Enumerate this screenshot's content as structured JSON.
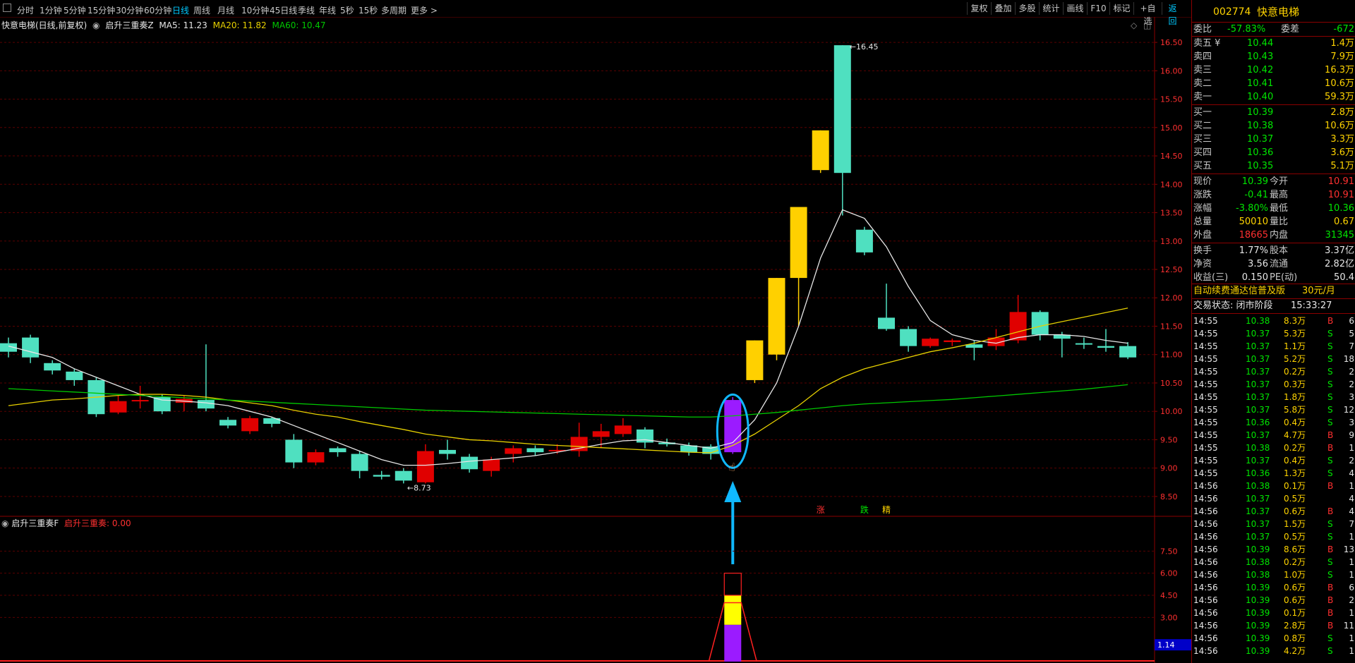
{
  "toolbar": {
    "periods": [
      "分时",
      "1分钟",
      "5分钟",
      "15分钟",
      "30分钟",
      "60分钟",
      "日线",
      "周线",
      "月线",
      "10分钟",
      "45日线",
      "季线",
      "年线",
      "5秒",
      "15秒",
      "多周期",
      "更多 >"
    ],
    "active_period": "日线",
    "right_buttons": [
      "复权",
      "叠加",
      "多股",
      "统计",
      "画线",
      "F10",
      "标记",
      "+自选",
      "返回"
    ]
  },
  "chart_header": {
    "stock_title": "快意电梯(日线,前复权)",
    "indicator_name": "启升三重奏Z",
    "ma5": "MA5: 11.23",
    "ma20": "MA20: 11.82",
    "ma60": "MA60: 10.47"
  },
  "indicator_header": {
    "name": "启升三重奏F",
    "value_label": "启升三重奏: 0.00"
  },
  "chart_data": [
    {
      "type": "candlestick",
      "title": "快意电梯(日线,前复权)",
      "y_ticks": [
        "16.50",
        "16.00",
        "15.50",
        "15.00",
        "14.50",
        "14.00",
        "13.50",
        "13.00",
        "12.50",
        "12.00",
        "11.50",
        "11.00",
        "10.50",
        "10.00",
        "9.50",
        "9.00",
        "8.50"
      ],
      "ylim": [
        8.3,
        16.7
      ],
      "high_label": "16.45",
      "low_label": "8.73",
      "candles": [
        {
          "o": 11.2,
          "c": 11.05,
          "h": 11.3,
          "l": 10.95
        },
        {
          "o": 11.3,
          "c": 10.95,
          "h": 11.35,
          "l": 10.85
        },
        {
          "o": 10.85,
          "c": 10.72,
          "h": 10.9,
          "l": 10.65
        },
        {
          "o": 10.7,
          "c": 10.55,
          "h": 10.75,
          "l": 10.45
        },
        {
          "o": 10.55,
          "c": 9.95,
          "h": 10.6,
          "l": 9.9
        },
        {
          "o": 9.98,
          "c": 10.18,
          "h": 10.28,
          "l": 9.95
        },
        {
          "o": 10.18,
          "c": 10.2,
          "h": 10.45,
          "l": 10.05
        },
        {
          "o": 10.25,
          "c": 10.0,
          "h": 10.3,
          "l": 9.95
        },
        {
          "o": 10.15,
          "c": 10.22,
          "h": 10.28,
          "l": 10.0
        },
        {
          "o": 10.2,
          "c": 10.05,
          "h": 11.18,
          "l": 10.0
        },
        {
          "o": 9.85,
          "c": 9.75,
          "h": 9.9,
          "l": 9.7
        },
        {
          "o": 9.65,
          "c": 9.88,
          "h": 9.92,
          "l": 9.6
        },
        {
          "o": 9.88,
          "c": 9.78,
          "h": 9.9,
          "l": 9.72
        },
        {
          "o": 9.5,
          "c": 9.1,
          "h": 9.6,
          "l": 9.0
        },
        {
          "o": 9.1,
          "c": 9.28,
          "h": 9.33,
          "l": 9.05
        },
        {
          "o": 9.35,
          "c": 9.28,
          "h": 9.38,
          "l": 9.2
        },
        {
          "o": 9.25,
          "c": 8.95,
          "h": 9.3,
          "l": 8.82
        },
        {
          "o": 8.88,
          "c": 8.85,
          "h": 8.95,
          "l": 8.8
        },
        {
          "o": 8.95,
          "c": 8.78,
          "h": 9.0,
          "l": 8.73
        },
        {
          "o": 8.75,
          "c": 9.3,
          "h": 9.42,
          "l": 8.73
        },
        {
          "o": 9.32,
          "c": 9.25,
          "h": 9.5,
          "l": 9.15
        },
        {
          "o": 9.2,
          "c": 8.98,
          "h": 9.25,
          "l": 8.92
        },
        {
          "o": 8.95,
          "c": 9.15,
          "h": 9.2,
          "l": 8.85
        },
        {
          "o": 9.25,
          "c": 9.35,
          "h": 9.4,
          "l": 9.1
        },
        {
          "o": 9.35,
          "c": 9.28,
          "h": 9.4,
          "l": 9.22
        },
        {
          "o": 9.3,
          "c": 9.32,
          "h": 9.42,
          "l": 9.25
        },
        {
          "o": 9.3,
          "c": 9.55,
          "h": 9.8,
          "l": 9.2
        },
        {
          "o": 9.55,
          "c": 9.65,
          "h": 9.78,
          "l": 9.35
        },
        {
          "o": 9.6,
          "c": 9.75,
          "h": 9.88,
          "l": 9.55
        },
        {
          "o": 9.68,
          "c": 9.45,
          "h": 9.72,
          "l": 9.35
        },
        {
          "o": 9.45,
          "c": 9.42,
          "h": 9.52,
          "l": 9.38
        },
        {
          "o": 9.4,
          "c": 9.28,
          "h": 9.45,
          "l": 9.22
        },
        {
          "o": 9.38,
          "c": 9.25,
          "h": 9.42,
          "l": 9.15
        },
        {
          "o": 9.28,
          "c": 10.2,
          "h": 10.25,
          "l": 9.25
        },
        {
          "o": 10.55,
          "c": 11.25,
          "h": 11.25,
          "l": 10.5
        },
        {
          "o": 11.0,
          "c": 12.35,
          "h": 12.35,
          "l": 10.9
        },
        {
          "o": 12.35,
          "c": 13.6,
          "h": 13.6,
          "l": 11.5
        },
        {
          "o": 14.25,
          "c": 14.95,
          "h": 14.95,
          "l": 14.2
        },
        {
          "o": 16.45,
          "c": 14.2,
          "h": 16.45,
          "l": 13.45
        },
        {
          "o": 13.2,
          "c": 12.8,
          "h": 13.25,
          "l": 12.75
        },
        {
          "o": 11.65,
          "c": 11.45,
          "h": 12.25,
          "l": 11.42
        },
        {
          "o": 11.45,
          "c": 11.15,
          "h": 11.5,
          "l": 11.05
        },
        {
          "o": 11.15,
          "c": 11.28,
          "h": 11.3,
          "l": 11.12
        },
        {
          "o": 11.22,
          "c": 11.25,
          "h": 11.28,
          "l": 11.15
        },
        {
          "o": 11.18,
          "c": 11.12,
          "h": 11.25,
          "l": 10.9
        },
        {
          "o": 11.15,
          "c": 11.3,
          "h": 11.45,
          "l": 11.08
        },
        {
          "o": 11.25,
          "c": 11.75,
          "h": 12.05,
          "l": 11.2
        },
        {
          "o": 11.75,
          "c": 11.35,
          "h": 11.78,
          "l": 11.25
        },
        {
          "o": 11.35,
          "c": 11.28,
          "h": 11.4,
          "l": 10.95
        },
        {
          "o": 11.2,
          "c": 11.18,
          "h": 11.3,
          "l": 11.1
        },
        {
          "o": 11.15,
          "c": 11.12,
          "h": 11.45,
          "l": 11.05
        },
        {
          "o": 11.15,
          "c": 10.95,
          "h": 11.22,
          "l": 10.92
        }
      ],
      "candle_styles": {
        "down": "#4fe0c0",
        "up": "#e00000",
        "gold": "#ffd000",
        "signal": "#9b1bff"
      },
      "gold_candles": [
        34,
        35,
        36,
        37
      ],
      "signal_candle": 33,
      "series": [
        {
          "name": "MA5",
          "color": "#e6e6e6",
          "values": [
            11.15,
            11.05,
            10.95,
            10.75,
            10.6,
            10.45,
            10.3,
            10.2,
            10.18,
            10.15,
            10.1,
            10.0,
            9.9,
            9.75,
            9.6,
            9.45,
            9.3,
            9.15,
            9.05,
            9.05,
            9.08,
            9.12,
            9.15,
            9.18,
            9.22,
            9.28,
            9.35,
            9.42,
            9.48,
            9.5,
            9.45,
            9.4,
            9.35,
            9.45,
            9.85,
            10.5,
            11.5,
            12.7,
            13.55,
            13.4,
            12.9,
            12.2,
            11.6,
            11.35,
            11.25,
            11.2,
            11.3,
            11.35,
            11.35,
            11.32,
            11.25,
            11.2
          ]
        },
        {
          "name": "MA20",
          "color": "#e6d000",
          "values": [
            10.1,
            10.15,
            10.2,
            10.22,
            10.25,
            10.28,
            10.3,
            10.3,
            10.28,
            10.25,
            10.2,
            10.15,
            10.1,
            10.02,
            9.95,
            9.9,
            9.82,
            9.75,
            9.68,
            9.6,
            9.55,
            9.5,
            9.48,
            9.45,
            9.42,
            9.4,
            9.38,
            9.36,
            9.34,
            9.32,
            9.3,
            9.28,
            9.27,
            9.4,
            9.6,
            9.85,
            10.1,
            10.4,
            10.6,
            10.75,
            10.85,
            10.95,
            11.05,
            11.12,
            11.2,
            11.3,
            11.4,
            11.5,
            11.58,
            11.66,
            11.74,
            11.82
          ]
        },
        {
          "name": "MA60",
          "color": "#00c800",
          "values": [
            10.4,
            10.38,
            10.36,
            10.34,
            10.32,
            10.3,
            10.28,
            10.26,
            10.24,
            10.22,
            10.2,
            10.18,
            10.16,
            10.14,
            10.12,
            10.1,
            10.08,
            10.06,
            10.04,
            10.02,
            10.01,
            10.0,
            9.99,
            9.98,
            9.97,
            9.96,
            9.95,
            9.94,
            9.93,
            9.92,
            9.91,
            9.9,
            9.9,
            9.92,
            9.95,
            9.98,
            10.02,
            10.06,
            10.1,
            10.13,
            10.15,
            10.17,
            10.19,
            10.21,
            10.24,
            10.27,
            10.3,
            10.33,
            10.36,
            10.39,
            10.43,
            10.47
          ]
        }
      ],
      "markers": [
        {
          "index": 37,
          "text": "涨",
          "color": "#ff3030"
        },
        {
          "index": 39,
          "text": "跌",
          "color": "#00e600"
        },
        {
          "index": 40,
          "text": "精",
          "color": "#ffd400"
        }
      ]
    },
    {
      "type": "bar",
      "title": "启升三重奏F",
      "y_ticks": [
        "7.50",
        "6.00",
        "4.50",
        "3.00"
      ],
      "ylim": [
        0,
        9.0
      ],
      "current_value_label": "1.14",
      "signal_index": 33,
      "stack": [
        {
          "from": 0,
          "to": 2.5,
          "color": "#9b1bff"
        },
        {
          "from": 2.5,
          "to": 4.5,
          "color": "#ffff00"
        },
        {
          "from": 4.5,
          "to": 6.0,
          "color": "#000000",
          "outline": "#ff2020"
        }
      ]
    }
  ],
  "quote_panel": {
    "code": "002774",
    "name": "快意电梯",
    "weibi_label": "委比",
    "weibi_value": "-57.83%",
    "weicha_label": "委差",
    "weicha_value": "-672",
    "sells": [
      {
        "label": "卖五 ¥",
        "price": "10.44",
        "vol": "1.4万"
      },
      {
        "label": "卖四",
        "price": "10.43",
        "vol": "7.9万"
      },
      {
        "label": "卖三",
        "price": "10.42",
        "vol": "16.3万"
      },
      {
        "label": "卖二",
        "price": "10.41",
        "vol": "10.6万"
      },
      {
        "label": "卖一",
        "price": "10.40",
        "vol": "59.3万"
      }
    ],
    "buys": [
      {
        "label": "买一",
        "price": "10.39",
        "vol": "2.8万"
      },
      {
        "label": "买二",
        "price": "10.38",
        "vol": "10.6万"
      },
      {
        "label": "买三",
        "price": "10.37",
        "vol": "3.3万"
      },
      {
        "label": "买四",
        "price": "10.36",
        "vol": "3.6万"
      },
      {
        "label": "买五",
        "price": "10.35",
        "vol": "5.1万"
      }
    ],
    "stats": [
      {
        "l1": "现价",
        "v1": "10.39",
        "c1": "green",
        "l2": "今开",
        "v2": "10.91",
        "c2": "red"
      },
      {
        "l1": "涨跌",
        "v1": "-0.41",
        "c1": "green",
        "l2": "最高",
        "v2": "10.91",
        "c2": "red"
      },
      {
        "l1": "涨幅",
        "v1": "-3.80%",
        "c1": "green",
        "l2": "最低",
        "v2": "10.36",
        "c2": "green"
      },
      {
        "l1": "总量",
        "v1": "50010",
        "c1": "yellow",
        "l2": "量比",
        "v2": "0.67",
        "c2": "yellow"
      },
      {
        "l1": "外盘",
        "v1": "18665",
        "c1": "red",
        "l2": "内盘",
        "v2": "31345",
        "c2": "green"
      }
    ],
    "stats2": [
      {
        "l1": "换手",
        "v1": "1.77%",
        "l2": "股本",
        "v2": "3.37亿"
      },
      {
        "l1": "净资",
        "v1": "3.56",
        "l2": "流通",
        "v2": "2.82亿"
      },
      {
        "l1": "收益(三)",
        "v1": "0.150",
        "l2": "PE(动)",
        "v2": "50.4"
      }
    ],
    "ad_text": "自动续费通达信普及版",
    "ad_price": "30元/月",
    "trade_status_label": "交易状态: 闭市阶段",
    "trade_time": "15:33:27"
  },
  "ticks": [
    {
      "t": "14:55",
      "p": "10.38",
      "v": "8.3万",
      "s": "B",
      "n": "6"
    },
    {
      "t": "14:55",
      "p": "10.37",
      "v": "5.3万",
      "s": "S",
      "n": "5"
    },
    {
      "t": "14:55",
      "p": "10.37",
      "v": "1.1万",
      "s": "S",
      "n": "7"
    },
    {
      "t": "14:55",
      "p": "10.37",
      "v": "5.2万",
      "s": "S",
      "n": "18"
    },
    {
      "t": "14:55",
      "p": "10.37",
      "v": "0.2万",
      "s": "S",
      "n": "2"
    },
    {
      "t": "14:55",
      "p": "10.37",
      "v": "0.3万",
      "s": "S",
      "n": "2"
    },
    {
      "t": "14:55",
      "p": "10.37",
      "v": "1.8万",
      "s": "S",
      "n": "3"
    },
    {
      "t": "14:55",
      "p": "10.37",
      "v": "5.8万",
      "s": "S",
      "n": "12"
    },
    {
      "t": "14:55",
      "p": "10.36",
      "v": "0.4万",
      "s": "S",
      "n": "3"
    },
    {
      "t": "14:55",
      "p": "10.37",
      "v": "4.7万",
      "s": "B",
      "n": "9"
    },
    {
      "t": "14:55",
      "p": "10.38",
      "v": "0.2万",
      "s": "B",
      "n": "1"
    },
    {
      "t": "14:55",
      "p": "10.37",
      "v": "0.4万",
      "s": "S",
      "n": "2"
    },
    {
      "t": "14:55",
      "p": "10.36",
      "v": "1.3万",
      "s": "S",
      "n": "4"
    },
    {
      "t": "14:56",
      "p": "10.38",
      "v": "0.1万",
      "s": "B",
      "n": "1"
    },
    {
      "t": "14:56",
      "p": "10.37",
      "v": "0.5万",
      "s": "",
      "n": "4"
    },
    {
      "t": "14:56",
      "p": "10.37",
      "v": "0.6万",
      "s": "B",
      "n": "4"
    },
    {
      "t": "14:56",
      "p": "10.37",
      "v": "1.5万",
      "s": "S",
      "n": "7"
    },
    {
      "t": "14:56",
      "p": "10.37",
      "v": "0.5万",
      "s": "S",
      "n": "1"
    },
    {
      "t": "14:56",
      "p": "10.39",
      "v": "8.6万",
      "s": "B",
      "n": "13"
    },
    {
      "t": "14:56",
      "p": "10.38",
      "v": "0.2万",
      "s": "S",
      "n": "1"
    },
    {
      "t": "14:56",
      "p": "10.38",
      "v": "1.0万",
      "s": "S",
      "n": "1"
    },
    {
      "t": "14:56",
      "p": "10.39",
      "v": "0.6万",
      "s": "B",
      "n": "6"
    },
    {
      "t": "14:56",
      "p": "10.39",
      "v": "0.6万",
      "s": "B",
      "n": "2"
    },
    {
      "t": "14:56",
      "p": "10.39",
      "v": "0.1万",
      "s": "B",
      "n": "1"
    },
    {
      "t": "14:56",
      "p": "10.39",
      "v": "2.8万",
      "s": "B",
      "n": "11"
    },
    {
      "t": "14:56",
      "p": "10.39",
      "v": "0.8万",
      "s": "S",
      "n": "1"
    },
    {
      "t": "14:56",
      "p": "10.39",
      "v": "4.2万",
      "s": "S",
      "n": "1"
    }
  ]
}
